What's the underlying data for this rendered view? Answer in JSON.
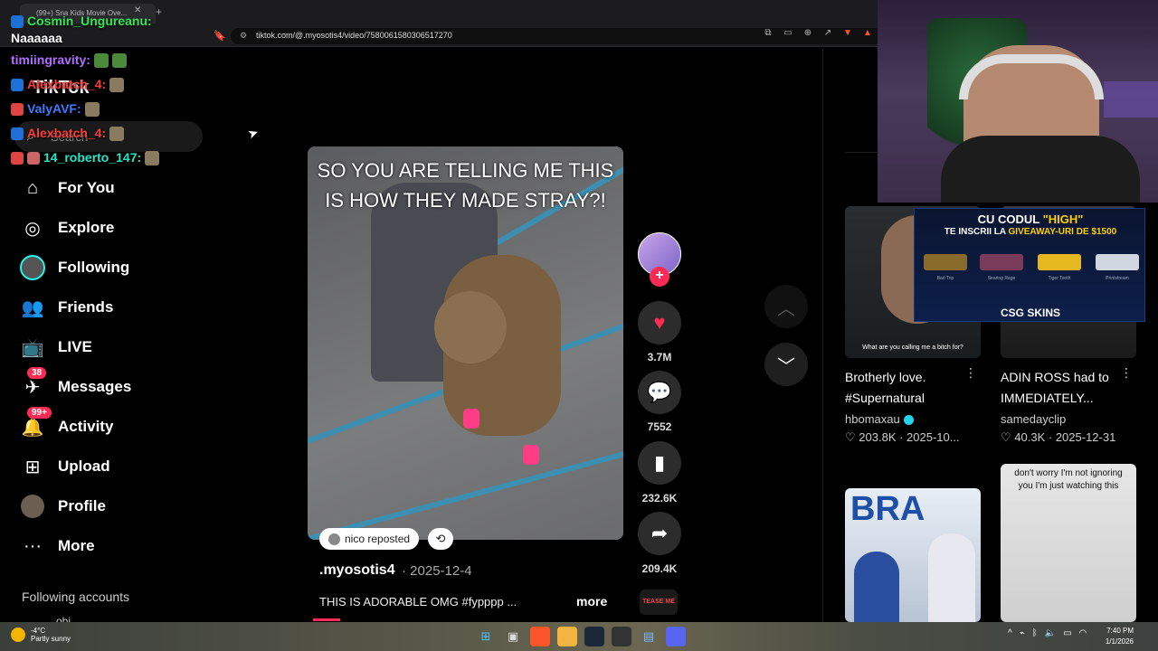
{
  "browser": {
    "tab_title": "(99+) Sna Kids Movie Ove...",
    "url": "tiktok.com/@.myosotis4/video/7580061580306517270"
  },
  "chat": [
    {
      "user": "Cosmin_Ungureanu:",
      "color": "#2ee85a",
      "message": ""
    },
    {
      "user": "",
      "color": "#ffffff",
      "message": "Naaaaaa"
    },
    {
      "user": "timiingravity:",
      "color": "#b26dff",
      "message": ""
    },
    {
      "user": "Alexbatch_4:",
      "color": "#ff3b3b",
      "message": ""
    },
    {
      "user": "ValyAVF:",
      "color": "#3b7cff",
      "message": ""
    },
    {
      "user": "Alexbatch_4:",
      "color": "#ff3b3b",
      "message": ""
    },
    {
      "user": "14_roberto_147:",
      "color": "#25e6c8",
      "message": ""
    }
  ],
  "sidebar": {
    "logo": "TikTok",
    "search_placeholder": "Search",
    "items": [
      {
        "label": "For You",
        "icon": "home-icon"
      },
      {
        "label": "Explore",
        "icon": "compass-icon"
      },
      {
        "label": "Following",
        "icon": "avatar"
      },
      {
        "label": "Friends",
        "icon": "friends-icon"
      },
      {
        "label": "LIVE",
        "icon": "live-icon"
      },
      {
        "label": "Messages",
        "icon": "messages-icon",
        "badge": "38"
      },
      {
        "label": "Activity",
        "icon": "activity-icon",
        "badge": "99+"
      },
      {
        "label": "Upload",
        "icon": "upload-icon"
      },
      {
        "label": "Profile",
        "icon": "avatar"
      },
      {
        "label": "More",
        "icon": "more-icon"
      }
    ],
    "following_accounts": "Following accounts",
    "following_partial": "obi"
  },
  "video": {
    "caption": "SO YOU ARE TELLING ME THIS IS HOW THEY MADE STRAY?!",
    "reposted_by": "nico reposted",
    "author": ".myosotis4",
    "date": "· 2025-12-4",
    "description": "THIS IS ADORABLE OMG #fypppp ...",
    "more_label": "more",
    "likes": "3.7M",
    "comments": "7552",
    "saves": "232.6K",
    "shares": "209.4K",
    "song_label": "TEASE ME"
  },
  "suggestions": [
    {
      "title": "Brotherly love. #Supernatural",
      "author": "hbomaxau",
      "verified": true,
      "likes": "203.8K",
      "date": "2025-10...",
      "thumb_text": "What are you calling me a bitch for?"
    },
    {
      "title": "ADIN ROSS had to IMMEDIATELY...",
      "author": "samedayclip",
      "verified": false,
      "likes": "40.3K",
      "date": "2025-12-31",
      "thumb_text": ""
    },
    {
      "title": "",
      "author": "",
      "verified": false,
      "likes": "",
      "date": "",
      "thumb_text": "BRA"
    },
    {
      "title": "",
      "author": "",
      "verified": false,
      "likes": "",
      "date": "",
      "thumb_text": "don't worry I'm not ignoring you I'm just watching this"
    }
  ],
  "ad": {
    "line1_pre": "CU CODUL ",
    "line1_code": "\"HIGH\"",
    "line2_pre": "TE INSCRII LA ",
    "line2_hl": "GIVEAWAY-URI DE $1500",
    "skins": [
      "Bad Trip",
      "Searing Rage",
      "Tiger Tooth",
      "Printstream"
    ],
    "brand": "CSG SKINS"
  },
  "taskbar": {
    "temp": "-4°C",
    "weather": "Partly sunny",
    "time": "7:40 PM",
    "date": "1/1/2026"
  },
  "colors": {
    "accent": "#fe2c55",
    "cyan": "#25f4ee"
  }
}
